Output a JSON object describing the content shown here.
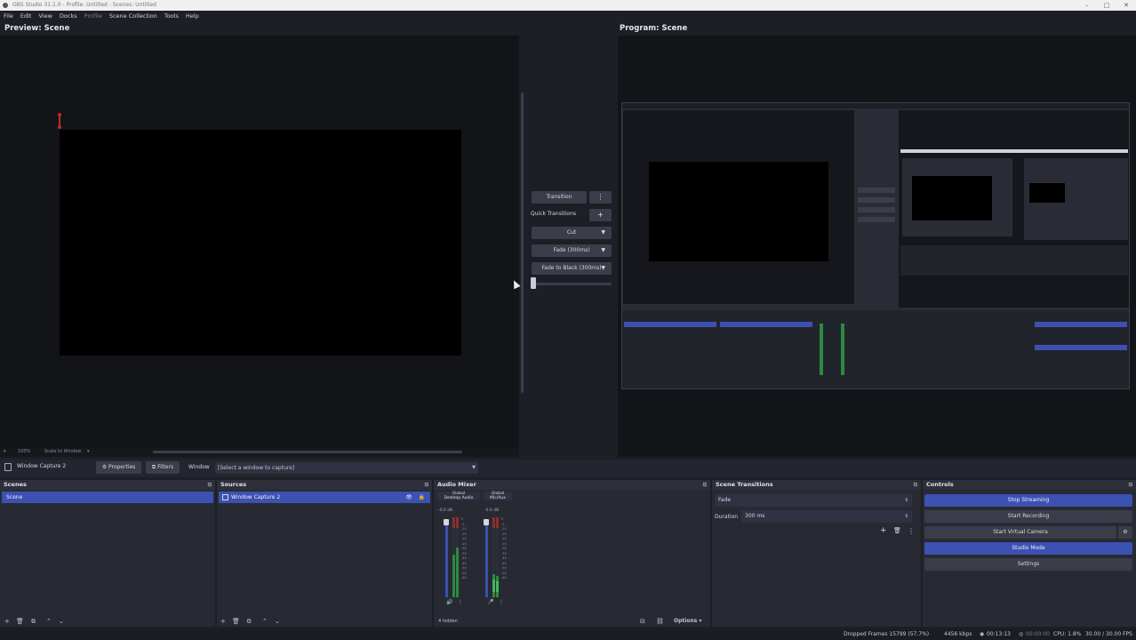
{
  "window": {
    "title": "OBS Studio 31.1.0 - Profile: Untitled - Scenes: Untitled"
  },
  "menu": [
    "File",
    "Edit",
    "View",
    "Docks",
    "Profile",
    "Scene Collection",
    "Tools",
    "Help"
  ],
  "preview": {
    "title": "Preview: Scene",
    "zoom": "100%",
    "zoom_mode": "Scale to Window"
  },
  "program": {
    "title": "Program: Scene"
  },
  "transitions_panel": {
    "transition_label": "Transition",
    "quick_label": "Quick Transitions",
    "quick_items": [
      "Cut",
      "Fade (300ms)",
      "Fade to Black (300ms)"
    ]
  },
  "source_toolbar": {
    "source_name": "Window Capture 2",
    "properties_label": "Properties",
    "filters_label": "Filters",
    "window_label": "Window",
    "window_value": "[Select a window to capture]"
  },
  "scenes": {
    "title": "Scenes",
    "items": [
      "Scene"
    ]
  },
  "sources": {
    "title": "Sources",
    "items": [
      "Window Capture 2"
    ]
  },
  "audio_mixer": {
    "title": "Audio Mixer",
    "channels": [
      {
        "type": "Global",
        "name": "Desktop Audio",
        "db": "-0.0 dB"
      },
      {
        "type": "Global",
        "name": "Mic/Aux",
        "db": "-0.0 dB"
      }
    ],
    "scale": [
      "0",
      "-5",
      "-10",
      "-15",
      "-20",
      "-25",
      "-30",
      "-35",
      "-40",
      "-45",
      "-50",
      "-55",
      "-60"
    ],
    "footer_text": "4 hidden",
    "options_label": "Options"
  },
  "scene_transitions": {
    "title": "Scene Transitions",
    "transition": "Fade",
    "duration_label": "Duration",
    "duration_value": "300 ms"
  },
  "controls": {
    "title": "Controls",
    "buttons": [
      "Stop Streaming",
      "Start Recording",
      "Start Virtual Camera",
      "Studio Mode",
      "Settings"
    ]
  },
  "status": {
    "dropped_frames": "Dropped Frames 15799 (57.7%)",
    "bitrate": "4456 kbps",
    "stream_time": "00:13:13",
    "rec_time": "00:00:00",
    "cpu": "CPU: 1.8%",
    "fps": "30.00 / 30.00 FPS"
  },
  "colors": {
    "accent": "#3c51b1",
    "background": "#1d1f26",
    "panel": "#272a33",
    "red_handle": "#c8262a"
  }
}
